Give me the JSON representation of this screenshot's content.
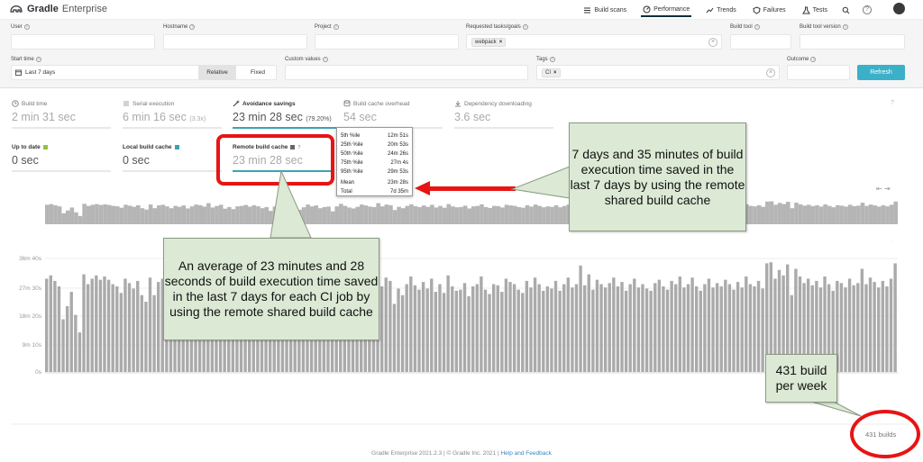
{
  "header": {
    "brand": "Gradle",
    "product": "Enterprise",
    "nav": [
      {
        "label": "Build scans",
        "active": false
      },
      {
        "label": "Performance",
        "active": true
      },
      {
        "label": "Trends",
        "active": false
      },
      {
        "label": "Failures",
        "active": false
      },
      {
        "label": "Tests",
        "active": false
      }
    ]
  },
  "filters": {
    "user": "User",
    "hostname": "Hostname",
    "project": "Project",
    "requested_tasks": "Requested tasks/goals",
    "requested_tasks_chip": "webpack",
    "build_tool": "Build tool",
    "build_tool_version": "Build tool version",
    "start_time": "Start time",
    "start_time_value": "Last 7 days",
    "relative": "Relative",
    "fixed": "Fixed",
    "custom_values": "Custom values",
    "tags": "Tags",
    "tags_chip": "CI",
    "outcome": "Outcome",
    "refresh": "Refresh"
  },
  "metrics": {
    "build_time": {
      "label": "Build time",
      "value": "2 min 31 sec"
    },
    "serial_execution": {
      "label": "Serial execution",
      "value": "6 min 16 sec",
      "extra": "(3.3x)"
    },
    "avoidance_savings": {
      "label": "Avoidance savings",
      "value": "23 min 28 sec",
      "pct": "(79.20%)"
    },
    "build_cache_overhead": {
      "label": "Build cache overhead",
      "value": "54 sec"
    },
    "dependency_downloading": {
      "label": "Dependency downloading",
      "value": "3.6 sec"
    },
    "up_to_date": {
      "label": "Up to date",
      "value": "0 sec"
    },
    "local_build_cache": {
      "label": "Local build cache",
      "value": "0 sec"
    },
    "remote_build_cache": {
      "label": "Remote build cache",
      "value": "23 min 28 sec"
    }
  },
  "tooltip": {
    "rows": [
      {
        "k": "5th %ile",
        "v": "12m 51s"
      },
      {
        "k": "25th %ile",
        "v": "20m 53s"
      },
      {
        "k": "50th %ile",
        "v": "24m 26s"
      },
      {
        "k": "75th %ile",
        "v": "27m 4s"
      },
      {
        "k": "95th %ile",
        "v": "29m 53s"
      }
    ],
    "mean_k": "Mean",
    "mean_v": "23m 28s",
    "total_k": "Total",
    "total_v": "7d 35m"
  },
  "chart_data": {
    "type": "bar",
    "ylabel": "",
    "y_ticks": [
      "36m 40s",
      "27m 30s",
      "18m 20s",
      "9m 10s",
      "0s"
    ],
    "ylim_seconds": [
      0,
      2200
    ],
    "values_seconds": [
      1700,
      1760,
      1660,
      1560,
      960,
      1200,
      1460,
      1040,
      720,
      1780,
      1600,
      1700,
      1760,
      1680,
      1740,
      1680,
      1600,
      1560,
      1440,
      1700,
      1620,
      1520,
      1660,
      1400,
      1280,
      1720,
      1400,
      1640,
      1700,
      1560,
      1400,
      1600,
      1520,
      1640,
      1380,
      1560,
      1720,
      1660,
      1540,
      1840,
      1460,
      1600,
      1700,
      1360,
      1500,
      1320,
      1560,
      1600,
      1680,
      1540,
      1660,
      1560,
      1400,
      1500,
      1160,
      1540,
      1640,
      1700,
      1560,
      1600,
      1520,
      1260,
      1480,
      1720,
      1560,
      1640,
      1400,
      1500,
      1540,
      1120,
      1560,
      1780,
      1600,
      1460,
      1380,
      1520,
      1720,
      1640,
      1540,
      1500,
      1840,
      1560,
      1720,
      1660,
      1240,
      1520,
      1400,
      1600,
      1740,
      1580,
      1500,
      1640,
      1520,
      1700,
      1460,
      1600,
      1440,
      1760,
      1560,
      1480,
      1500,
      1620,
      1380,
      1560,
      1600,
      1740,
      1500,
      1420,
      1600,
      1580,
      1460,
      1700,
      1640,
      1600,
      1500,
      1440,
      1660,
      1540,
      1720,
      1600,
      1480,
      1560,
      1520,
      1660,
      1480,
      1600,
      1720,
      1540,
      1600,
      1940,
      1580,
      1780,
      1500,
      1680,
      1600,
      1540,
      1620,
      1720,
      1560,
      1640,
      1480,
      1600,
      1700,
      1540,
      1600,
      1520,
      1480,
      1620,
      1680,
      1560,
      1500,
      1660,
      1600,
      1740,
      1540,
      1600,
      1720,
      1560,
      1480,
      1600,
      1700,
      1540,
      1620,
      1560,
      1680,
      1600,
      1500,
      1640,
      1540,
      1740,
      1600,
      1560,
      1660,
      1520,
      1980,
      2000,
      1700,
      1860,
      1760,
      1960,
      1400,
      1880,
      1740,
      1620,
      1700,
      1580,
      1660,
      1540,
      1740,
      1600,
      1480,
      1660,
      1620,
      1540,
      1700,
      1580,
      1620,
      1880,
      1600,
      1720,
      1640,
      1540,
      1660,
      1560,
      1700,
      1980
    ]
  },
  "annotations": {
    "main": "An average of 23 minutes and 28 seconds of build execution time saved in the last 7 days for each CI job by using the remote shared build cache",
    "right": "7 days and 35 minutes of build execution time saved in the last 7 days by using the remote shared build cache",
    "bottom_right": "431 build per week"
  },
  "builds_count": "431 builds",
  "footer": {
    "text": "Gradle Enterprise 2021.2.3 | © Gradle Inc. 2021 |",
    "link": "Help and Feedback"
  },
  "colors": {
    "accent": "#3aa3b5",
    "refresh": "#3bb0c9",
    "bar": "#aaaaaa",
    "callout_bg": "#dce9d5",
    "highlight_red": "#e81414"
  }
}
